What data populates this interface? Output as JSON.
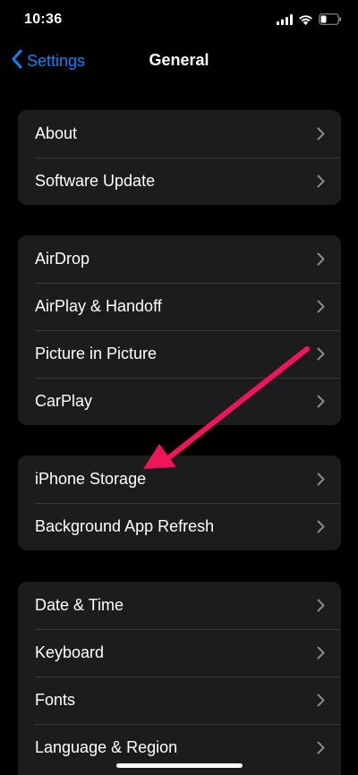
{
  "status_bar": {
    "time": "10:36"
  },
  "nav": {
    "back_label": "Settings",
    "title": "General"
  },
  "groups": [
    {
      "items": [
        {
          "label": "About"
        },
        {
          "label": "Software Update"
        }
      ]
    },
    {
      "items": [
        {
          "label": "AirDrop"
        },
        {
          "label": "AirPlay & Handoff"
        },
        {
          "label": "Picture in Picture"
        },
        {
          "label": "CarPlay"
        }
      ]
    },
    {
      "items": [
        {
          "label": "iPhone Storage"
        },
        {
          "label": "Background App Refresh"
        }
      ]
    },
    {
      "items": [
        {
          "label": "Date & Time"
        },
        {
          "label": "Keyboard"
        },
        {
          "label": "Fonts"
        },
        {
          "label": "Language & Region"
        }
      ]
    }
  ],
  "colors": {
    "accent": "#0a84ff",
    "background": "#000000",
    "cell": "#1c1c1e",
    "annotation_arrow": "#f0145a"
  }
}
